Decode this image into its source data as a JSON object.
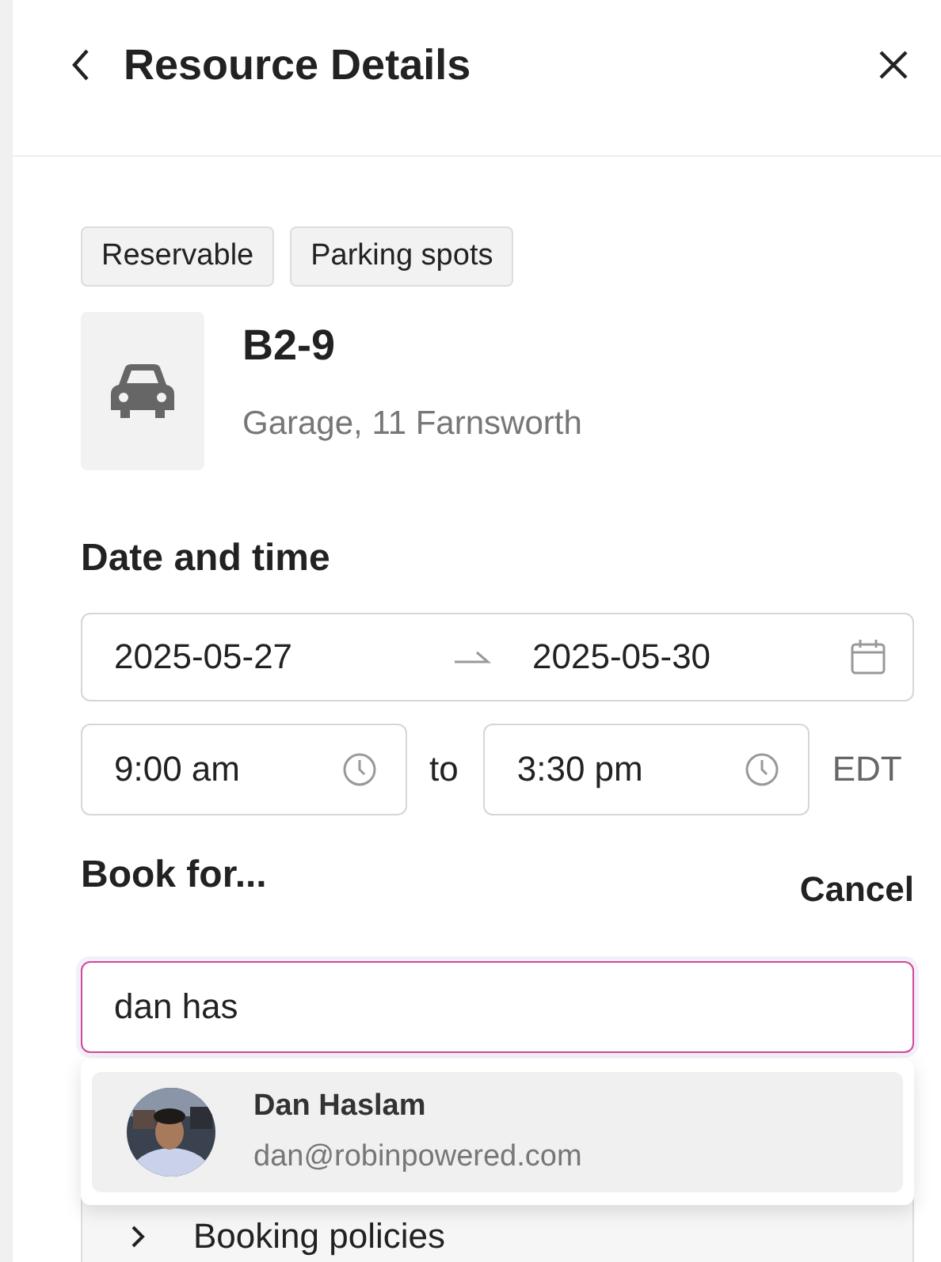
{
  "header": {
    "title": "Resource Details"
  },
  "tags": [
    "Reservable",
    "Parking spots"
  ],
  "resource": {
    "name": "B2-9",
    "location": "Garage, 11 Farnsworth"
  },
  "date_time": {
    "heading": "Date and time",
    "start_date": "2025-05-27",
    "end_date": "2025-05-30",
    "start_time": "9:00 am",
    "to_label": "to",
    "end_time": "3:30 pm",
    "timezone": "EDT"
  },
  "book_for": {
    "heading": "Book for...",
    "cancel": "Cancel",
    "value": "dan has"
  },
  "suggestions": [
    {
      "name": "Dan Haslam",
      "email": "dan@robinpowered.com",
      "selected": true
    }
  ],
  "sections": [
    {
      "label": "Booking policies",
      "expanded": false
    }
  ]
}
